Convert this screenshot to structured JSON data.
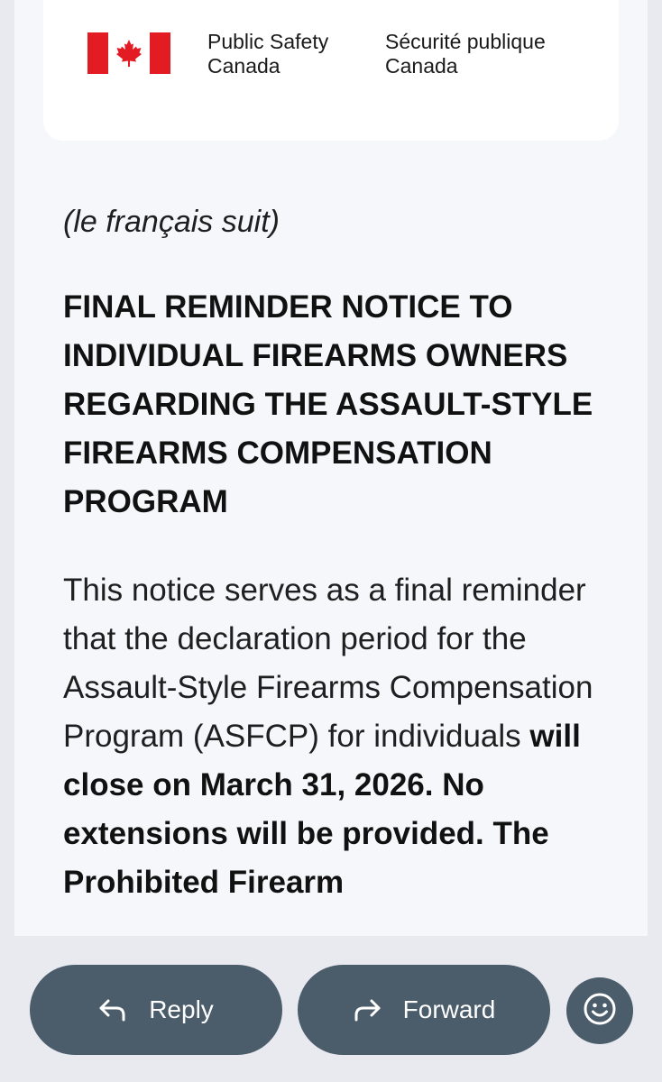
{
  "header": {
    "department_en_line1": "Public Safety",
    "department_en_line2": "Canada",
    "department_fr_line1": "Sécurité publique",
    "department_fr_line2": "Canada",
    "flag_icon": "canada-flag-icon"
  },
  "message": {
    "language_note": "(le français suit)",
    "title": "FINAL REMINDER NOTICE TO INDIVIDUAL FIREARMS OWNERS REGARDING THE ASSAULT-STYLE FIREARMS COMPENSATION PROGRAM",
    "body_regular": "This notice serves as a final reminder that the declaration period for the Assault-Style Firearms Compensation Program (ASFCP) for individuals",
    "body_bold_1": "will close on March 31, 2026.",
    "body_bold_2": "No extensions will be provided.",
    "body_bold_3_partial": "The Prohibited Firearm"
  },
  "actions": {
    "reply_label": "Reply",
    "reply_icon": "reply-arrow-icon",
    "forward_label": "Forward",
    "forward_icon": "forward-arrow-icon",
    "emoji_icon": "emoji-reaction-icon"
  },
  "colors": {
    "flag_red": "#e31b23",
    "button_bg": "#4b5c6b",
    "page_bg": "#e8eaef",
    "email_bg": "#f5f7fb"
  }
}
